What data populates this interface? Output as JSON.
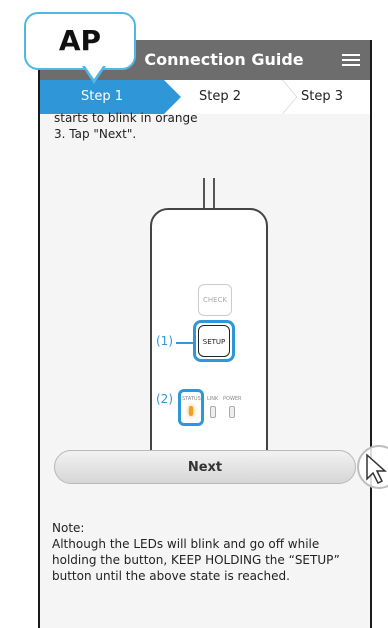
{
  "header": {
    "title": "Connection Guide",
    "back_icon": "chevron-left-icon",
    "menu_icon": "hamburger-menu-icon"
  },
  "badge": {
    "text": "AP"
  },
  "steps": [
    {
      "label": "Step 1",
      "active": true
    },
    {
      "label": "Step 2",
      "active": false
    },
    {
      "label": "Step 3",
      "active": false
    }
  ],
  "instructions": {
    "line1": "starts to blink in orange",
    "line2": "3. Tap  \"Next\"."
  },
  "device": {
    "check_label": "CHECK",
    "setup_label": "SETUP",
    "callout1": "(1)",
    "callout2": "(2)",
    "led_labels": [
      "STATUS",
      "LINK",
      "POWER"
    ],
    "status_led_color": "#f0a020"
  },
  "next_button": {
    "label": "Next"
  },
  "note": {
    "heading": "Note:",
    "body": "Although the LEDs will blink and go off while holding the button, KEEP HOLDING the “SETUP” button until the above state is reached."
  },
  "colors": {
    "accent": "#2f97d8",
    "titlebar": "#6d6d6d",
    "badge_border": "#4db8e8"
  }
}
